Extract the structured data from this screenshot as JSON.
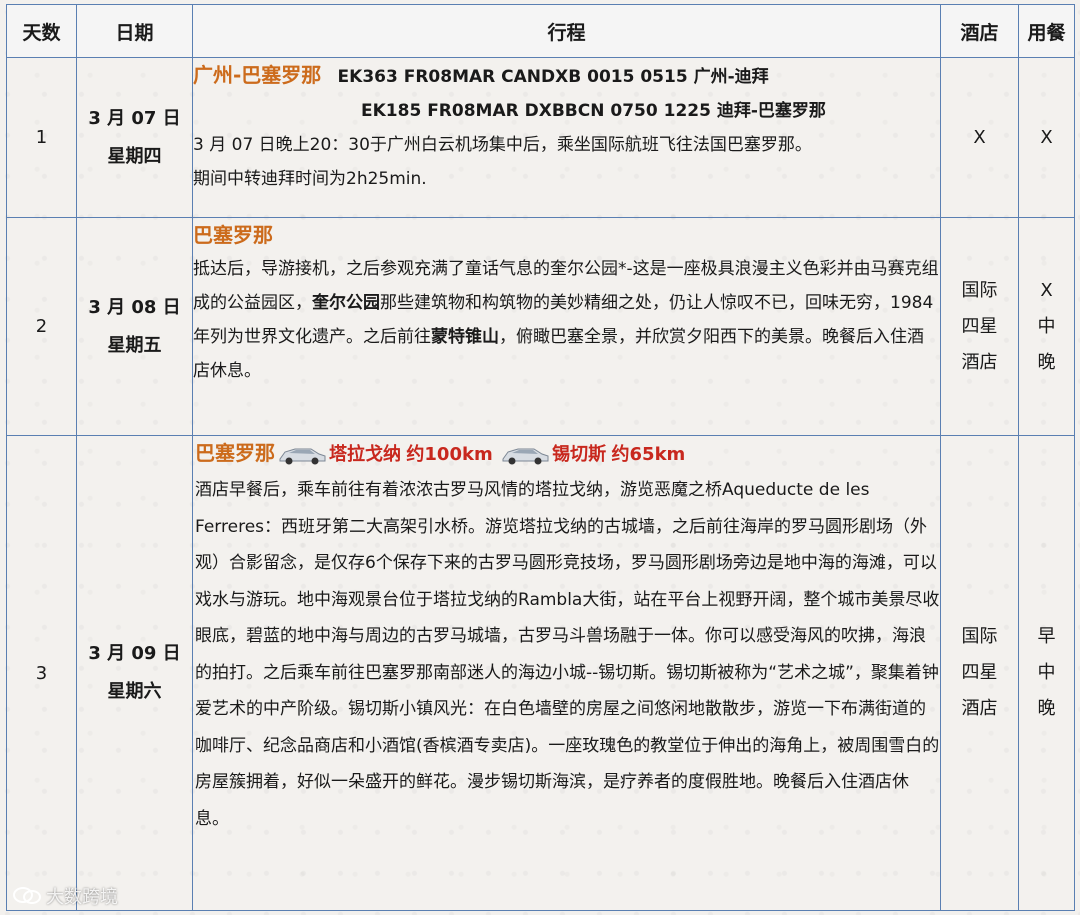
{
  "headers": {
    "day": "天数",
    "date": "日期",
    "itinerary": "行程",
    "hotel": "酒店",
    "meals": "用餐"
  },
  "rows": [
    {
      "day": "1",
      "date": "3 月 07 日",
      "weekday": "星期四",
      "route": "广州-巴塞罗那",
      "flight1": "EK363 FR08MAR CANDXB 0015 0515 广州-迪拜",
      "flight2": "EK185 FR08MAR DXBBCN 0750 1225  迪拜-巴塞罗那",
      "text1": "3 月 07 日晚上20：30于广州白云机场集中后，乘坐国际航班飞往法国巴塞罗那。",
      "text2": "期间中转迪拜时间为2h25min.",
      "hotel": "X",
      "meals": "X"
    },
    {
      "day": "2",
      "date": "3 月 08 日",
      "weekday": "星期五",
      "route": "巴塞罗那",
      "text_a": "抵达后，导游接机，之后参观充满了童话气息的奎尔公园*-这是一座极具浪漫主义色彩并由马赛克组成的公益园区，",
      "bold_a": "奎尔公园",
      "text_b": "那些建筑物和构筑物的美妙精细之处，仍让人惊叹不已，回味无穷，1984年列为世界文化遗产。之后前往",
      "bold_b": "蒙特锥山",
      "text_c": "，俯瞰巴塞全景，并欣赏夕阳西下的美景。晚餐后入住酒店休息。",
      "hotel": [
        "国际",
        "四星",
        "酒店"
      ],
      "meals": [
        "X",
        "中",
        "晚"
      ]
    },
    {
      "day": "3",
      "date": "3 月 09 日",
      "weekday": "星期六",
      "route_a": "巴塞罗那",
      "route_b": "塔拉戈纳",
      "dist_b": "约100km",
      "route_c": "锡切斯",
      "dist_c": "约65km",
      "text": "酒店早餐后，乘车前往有着浓浓古罗马风情的塔拉戈纳，游览恶魔之桥Aqueducte de les Ferreres：西班牙第二大高架引水桥。游览塔拉戈纳的古城墙，之后前往海岸的罗马圆形剧场（外观）合影留念，是仅存6个保存下来的古罗马圆形竞技场，罗马圆形剧场旁边是地中海的海滩，可以戏水与游玩。地中海观景台位于塔拉戈纳的Rambla大街，站在平台上视野开阔，整个城市美景尽收眼底，碧蓝的地中海与周边的古罗马城墙，古罗马斗兽场融于一体。你可以感受海风的吹拂，海浪的拍打。之后乘车前往巴塞罗那南部迷人的海边小城--锡切斯。锡切斯被称为“艺术之城”，聚集着钟爱艺术的中产阶级。锡切斯小镇风光：在白色墙壁的房屋之间悠闲地散散步，游览一下布满街道的咖啡厅、纪念品商店和小酒馆(香槟酒专卖店)。一座玫瑰色的教堂位于伸出的海角上，被周围雪白的房屋簇拥着，好似一朵盛开的鲜花。漫步锡切斯海滨，是疗养者的度假胜地。晚餐后入住酒店休息。",
      "hotel": [
        "国际",
        "四星",
        "酒店"
      ],
      "meals": [
        "早",
        "中",
        "晚"
      ]
    }
  ],
  "watermark": "大数跨境",
  "icons": {
    "car": "car-icon",
    "logo": "chat-logo-icon"
  }
}
